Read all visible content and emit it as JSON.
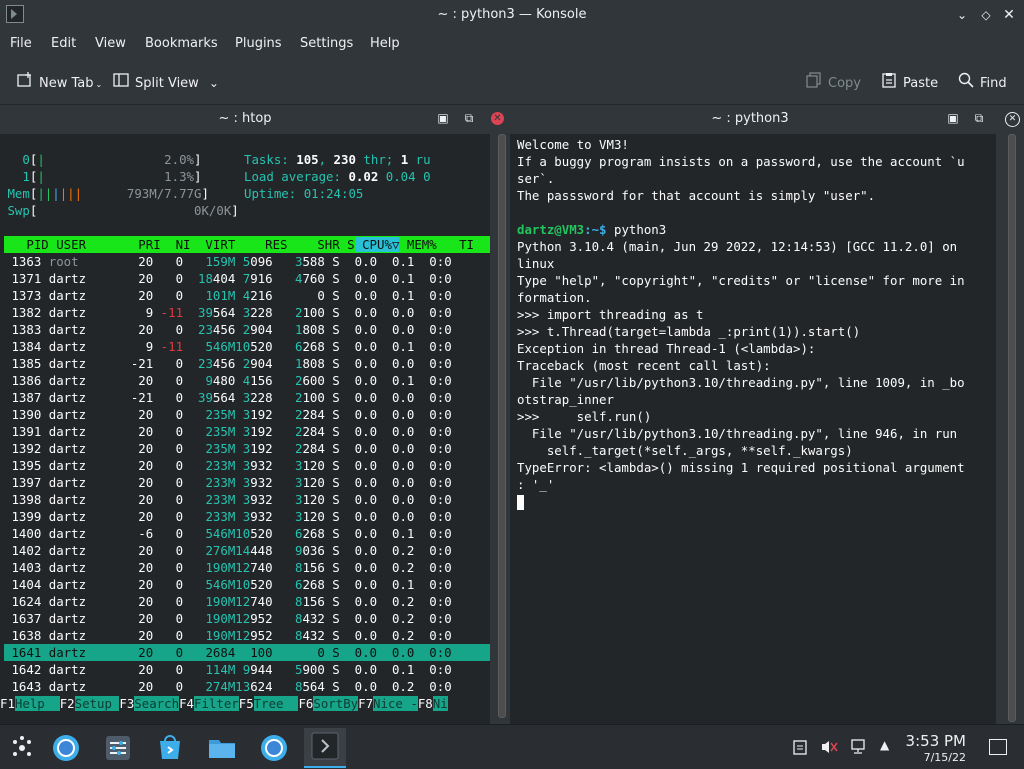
{
  "window": {
    "title": "~ : python3 — Konsole"
  },
  "menubar": {
    "items": [
      "File",
      "Edit",
      "View",
      "Bookmarks",
      "Plugins",
      "Settings",
      "Help"
    ]
  },
  "toolbar": {
    "new_tab": "New Tab",
    "split_view": "Split View",
    "copy": "Copy",
    "paste": "Paste",
    "find": "Find"
  },
  "panes": {
    "left_title": "~ : htop",
    "right_title": "~ : python3"
  },
  "htop": {
    "cpu0_label": "0",
    "cpu0_val": "2.0%",
    "cpu1_label": "1",
    "cpu1_val": "1.3%",
    "mem_label": "Mem",
    "mem_val": "793M/7.77G",
    "swp_label": "Swp",
    "swp_val": "0K/0K",
    "tasks_label": "Tasks:",
    "tasks": "105",
    "thr": "230",
    "thr_label": "thr;",
    "running": "1",
    "running_label": "ru",
    "load_label": "Load average:",
    "load1": "0.02",
    "load5": "0.04",
    "load15": "0",
    "uptime_label": "Uptime:",
    "uptime": "01:24:05",
    "header": [
      "PID",
      "USER",
      "PRI",
      "NI",
      "VIRT",
      "RES",
      "SHR",
      "S",
      "CPU%",
      "MEM%",
      "TI"
    ],
    "processes": [
      {
        "pid": "1363",
        "user": "root",
        "pri": "20",
        "ni": "0",
        "virt": "159M",
        "res": "5096",
        "shr": "3588",
        "s": "S",
        "cpu": "0.0",
        "mem": "0.1",
        "time": "0:0"
      },
      {
        "pid": "1371",
        "user": "dartz",
        "pri": "20",
        "ni": "0",
        "virt": "18404",
        "res": "7916",
        "shr": "4760",
        "s": "S",
        "cpu": "0.0",
        "mem": "0.1",
        "time": "0:0"
      },
      {
        "pid": "1373",
        "user": "dartz",
        "pri": "20",
        "ni": "0",
        "virt": "101M",
        "res": "4216",
        "shr": "0",
        "s": "S",
        "cpu": "0.0",
        "mem": "0.1",
        "time": "0:0"
      },
      {
        "pid": "1382",
        "user": "dartz",
        "pri": "9",
        "ni": "-11",
        "virt": "39564",
        "res": "3228",
        "shr": "2100",
        "s": "S",
        "cpu": "0.0",
        "mem": "0.0",
        "time": "0:0"
      },
      {
        "pid": "1383",
        "user": "dartz",
        "pri": "20",
        "ni": "0",
        "virt": "23456",
        "res": "2904",
        "shr": "1808",
        "s": "S",
        "cpu": "0.0",
        "mem": "0.0",
        "time": "0:0"
      },
      {
        "pid": "1384",
        "user": "dartz",
        "pri": "9",
        "ni": "-11",
        "virt": "546M",
        "res": "10520",
        "shr": "6268",
        "s": "S",
        "cpu": "0.0",
        "mem": "0.1",
        "time": "0:0"
      },
      {
        "pid": "1385",
        "user": "dartz",
        "pri": "-21",
        "ni": "0",
        "virt": "23456",
        "res": "2904",
        "shr": "1808",
        "s": "S",
        "cpu": "0.0",
        "mem": "0.0",
        "time": "0:0"
      },
      {
        "pid": "1386",
        "user": "dartz",
        "pri": "20",
        "ni": "0",
        "virt": "9480",
        "res": "4156",
        "shr": "2600",
        "s": "S",
        "cpu": "0.0",
        "mem": "0.1",
        "time": "0:0"
      },
      {
        "pid": "1387",
        "user": "dartz",
        "pri": "-21",
        "ni": "0",
        "virt": "39564",
        "res": "3228",
        "shr": "2100",
        "s": "S",
        "cpu": "0.0",
        "mem": "0.0",
        "time": "0:0"
      },
      {
        "pid": "1390",
        "user": "dartz",
        "pri": "20",
        "ni": "0",
        "virt": "235M",
        "res": "3192",
        "shr": "2284",
        "s": "S",
        "cpu": "0.0",
        "mem": "0.0",
        "time": "0:0"
      },
      {
        "pid": "1391",
        "user": "dartz",
        "pri": "20",
        "ni": "0",
        "virt": "235M",
        "res": "3192",
        "shr": "2284",
        "s": "S",
        "cpu": "0.0",
        "mem": "0.0",
        "time": "0:0"
      },
      {
        "pid": "1392",
        "user": "dartz",
        "pri": "20",
        "ni": "0",
        "virt": "235M",
        "res": "3192",
        "shr": "2284",
        "s": "S",
        "cpu": "0.0",
        "mem": "0.0",
        "time": "0:0"
      },
      {
        "pid": "1395",
        "user": "dartz",
        "pri": "20",
        "ni": "0",
        "virt": "233M",
        "res": "3932",
        "shr": "3120",
        "s": "S",
        "cpu": "0.0",
        "mem": "0.0",
        "time": "0:0"
      },
      {
        "pid": "1397",
        "user": "dartz",
        "pri": "20",
        "ni": "0",
        "virt": "233M",
        "res": "3932",
        "shr": "3120",
        "s": "S",
        "cpu": "0.0",
        "mem": "0.0",
        "time": "0:0"
      },
      {
        "pid": "1398",
        "user": "dartz",
        "pri": "20",
        "ni": "0",
        "virt": "233M",
        "res": "3932",
        "shr": "3120",
        "s": "S",
        "cpu": "0.0",
        "mem": "0.0",
        "time": "0:0"
      },
      {
        "pid": "1399",
        "user": "dartz",
        "pri": "20",
        "ni": "0",
        "virt": "233M",
        "res": "3932",
        "shr": "3120",
        "s": "S",
        "cpu": "0.0",
        "mem": "0.0",
        "time": "0:0"
      },
      {
        "pid": "1400",
        "user": "dartz",
        "pri": "-6",
        "ni": "0",
        "virt": "546M",
        "res": "10520",
        "shr": "6268",
        "s": "S",
        "cpu": "0.0",
        "mem": "0.1",
        "time": "0:0"
      },
      {
        "pid": "1402",
        "user": "dartz",
        "pri": "20",
        "ni": "0",
        "virt": "276M",
        "res": "14448",
        "shr": "9036",
        "s": "S",
        "cpu": "0.0",
        "mem": "0.2",
        "time": "0:0"
      },
      {
        "pid": "1403",
        "user": "dartz",
        "pri": "20",
        "ni": "0",
        "virt": "190M",
        "res": "12740",
        "shr": "8156",
        "s": "S",
        "cpu": "0.0",
        "mem": "0.2",
        "time": "0:0"
      },
      {
        "pid": "1404",
        "user": "dartz",
        "pri": "20",
        "ni": "0",
        "virt": "546M",
        "res": "10520",
        "shr": "6268",
        "s": "S",
        "cpu": "0.0",
        "mem": "0.1",
        "time": "0:0"
      },
      {
        "pid": "1624",
        "user": "dartz",
        "pri": "20",
        "ni": "0",
        "virt": "190M",
        "res": "12740",
        "shr": "8156",
        "s": "S",
        "cpu": "0.0",
        "mem": "0.2",
        "time": "0:0"
      },
      {
        "pid": "1637",
        "user": "dartz",
        "pri": "20",
        "ni": "0",
        "virt": "190M",
        "res": "12952",
        "shr": "8432",
        "s": "S",
        "cpu": "0.0",
        "mem": "0.2",
        "time": "0:0"
      },
      {
        "pid": "1638",
        "user": "dartz",
        "pri": "20",
        "ni": "0",
        "virt": "190M",
        "res": "12952",
        "shr": "8432",
        "s": "S",
        "cpu": "0.0",
        "mem": "0.2",
        "time": "0:0"
      },
      {
        "pid": "1641",
        "user": "dartz",
        "pri": "20",
        "ni": "0",
        "virt": "2684",
        "res": "100",
        "shr": "0",
        "s": "S",
        "cpu": "0.0",
        "mem": "0.0",
        "time": "0:0",
        "selected": true
      },
      {
        "pid": "1642",
        "user": "dartz",
        "pri": "20",
        "ni": "0",
        "virt": "114M",
        "res": "9944",
        "shr": "5900",
        "s": "S",
        "cpu": "0.0",
        "mem": "0.1",
        "time": "0:0"
      },
      {
        "pid": "1643",
        "user": "dartz",
        "pri": "20",
        "ni": "0",
        "virt": "274M",
        "res": "13624",
        "shr": "8564",
        "s": "S",
        "cpu": "0.0",
        "mem": "0.2",
        "time": "0:0"
      }
    ],
    "fkeys": [
      {
        "key": "F1",
        "label": "Help  "
      },
      {
        "key": "F2",
        "label": "Setup "
      },
      {
        "key": "F3",
        "label": "Search"
      },
      {
        "key": "F4",
        "label": "Filter"
      },
      {
        "key": "F5",
        "label": "Tree  "
      },
      {
        "key": "F6",
        "label": "SortBy"
      },
      {
        "key": "F7",
        "label": "Nice -"
      },
      {
        "key": "F8",
        "label": "Ni"
      }
    ]
  },
  "python": {
    "lines": [
      "Welcome to VM3!",
      "If a buggy program insists on a password, use the account `u",
      "ser`.",
      "The passsword for that account is simply \"user\".",
      "",
      "",
      "Python 3.10.4 (main, Jun 29 2022, 12:14:53) [GCC 11.2.0] on",
      "linux",
      "Type \"help\", \"copyright\", \"credits\" or \"license\" for more in",
      "formation.",
      ">>> import threading as t",
      ">>> t.Thread(target=lambda _:print(1)).start()",
      "Exception in thread Thread-1 (<lambda>):",
      "Traceback (most recent call last):",
      "  File \"/usr/lib/python3.10/threading.py\", line 1009, in _bo",
      "otstrap_inner",
      ">>>     self.run()",
      "  File \"/usr/lib/python3.10/threading.py\", line 946, in run",
      "    self._target(*self._args, **self._kwargs)",
      "TypeError: <lambda>() missing 1 required positional argument",
      ": '_'"
    ],
    "prompt_user": "dartz@VM3",
    "prompt_path": ":~$",
    "prompt_cmd": " python3"
  },
  "taskbar": {
    "time": "3:53 PM",
    "date": "7/15/22"
  }
}
